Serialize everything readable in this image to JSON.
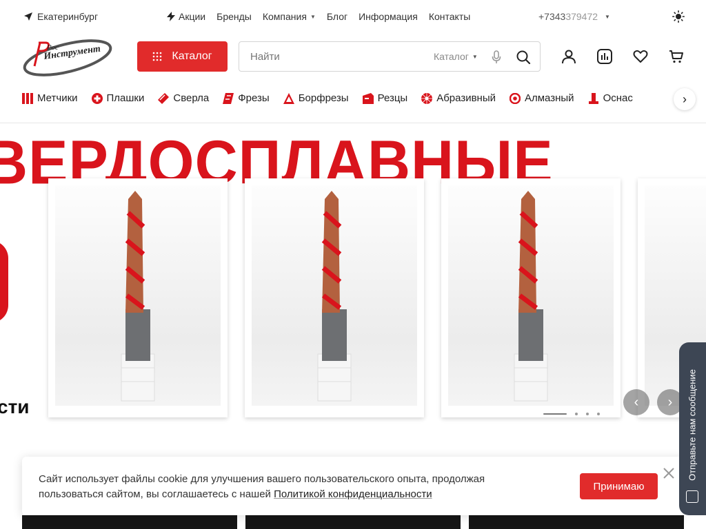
{
  "topbar": {
    "city": "Екатеринбург",
    "nav": [
      {
        "label": "Акции"
      },
      {
        "label": "Бренды"
      },
      {
        "label": "Компания"
      },
      {
        "label": "Блог"
      },
      {
        "label": "Информация"
      },
      {
        "label": "Контакты"
      }
    ],
    "phone_prefix": "+7343",
    "phone_rest": "379472"
  },
  "logo": {
    "text_top": "Рос",
    "text_bottom": "Инструмент"
  },
  "header": {
    "catalog_label": "Каталог",
    "search_placeholder": "Найти",
    "search_scope": "Каталог"
  },
  "categories": [
    {
      "label": "Метчики",
      "icon": "taps-icon"
    },
    {
      "label": "Плашки",
      "icon": "dies-icon"
    },
    {
      "label": "Сверла",
      "icon": "drills-icon"
    },
    {
      "label": "Фрезы",
      "icon": "mills-icon"
    },
    {
      "label": "Борфрезы",
      "icon": "burrs-icon"
    },
    {
      "label": "Резцы",
      "icon": "cutters-icon"
    },
    {
      "label": "Абразивный",
      "icon": "abrasive-icon"
    },
    {
      "label": "Алмазный",
      "icon": "diamond-icon"
    },
    {
      "label": "Оснас",
      "icon": "tooling-icon"
    }
  ],
  "banner": {
    "title": "ВЕРДОСПЛАВНЫЕ",
    "subtitle": "сти"
  },
  "cookie": {
    "text": "Сайт использует файлы cookie для улучшения вашего пользовательского опыта, продолжая пользоваться сайтом, вы соглашаетесь с нашей ",
    "link": "Политикой конфиденциальности",
    "accept": "Принимаю"
  },
  "side_widget": {
    "label": "Отправьте нам сообщение"
  },
  "colors": {
    "accent": "#e12b2b",
    "banner_red": "#d9141c",
    "widget": "#3d4654"
  }
}
